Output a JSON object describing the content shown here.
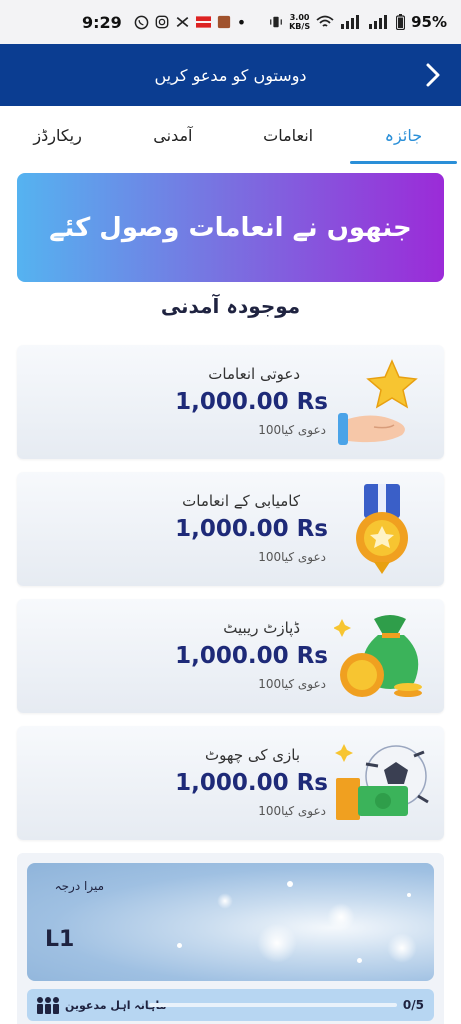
{
  "status_bar": {
    "time": "9:29",
    "network_speed_top": "3.00",
    "network_speed_unit": "KB/S",
    "battery": "95%"
  },
  "header": {
    "title": "دوستوں کو مدعو کریں",
    "back_icon": "chevron-right-icon"
  },
  "tabs": [
    {
      "label": "جائزہ",
      "active": true
    },
    {
      "label": "انعامات",
      "active": false
    },
    {
      "label": "آمدنی",
      "active": false
    },
    {
      "label": "ریکارڈز",
      "active": false
    }
  ],
  "hero": {
    "text": "جنھوں نے انعامات وصول کئے"
  },
  "current_earnings_title": "موجودہ آمدنی",
  "cards": [
    {
      "title": "دعوتی انعامات",
      "amount": "1,000.00 Rs",
      "claimed_count": "100",
      "claimed_label": "دعوی کیا",
      "icon": "star-hand-icon"
    },
    {
      "title": "کامیابی کے انعامات",
      "amount": "1,000.00 Rs",
      "claimed_count": "100",
      "claimed_label": "دعوی کیا",
      "icon": "medal-icon"
    },
    {
      "title": "ڈپازٹ ریبیٹ",
      "amount": "1,000.00 Rs",
      "claimed_count": "100",
      "claimed_label": "دعوی کیا",
      "icon": "money-bag-coins-icon"
    },
    {
      "title": "بازی کی چھوٹ",
      "amount": "1,000.00 Rs",
      "claimed_count": "100",
      "claimed_label": "دعوی کیا",
      "icon": "football-cash-icon"
    }
  ],
  "level": {
    "label": "میرا درجہ",
    "value": "L1",
    "monthly_label": "ماہانہ اہل مدعوین",
    "progress_text": "0/5",
    "progress_fraction": 0
  },
  "colors": {
    "header_bg": "#0b3d91",
    "tab_active": "#2a8fd8",
    "amount": "#1e2a78",
    "hero_gradient_start": "#55b3f0",
    "hero_gradient_end": "#9b2bd8"
  }
}
